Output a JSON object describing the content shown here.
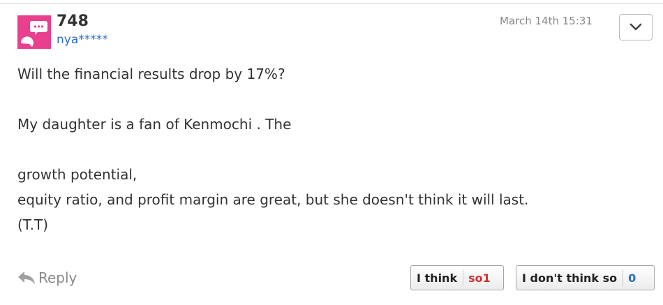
{
  "post": {
    "number": "748",
    "username": "nya*****",
    "timestamp": "March 14th 15:31",
    "body": {
      "line1": "Will the financial results drop by 17%?",
      "line2": "My daughter is a fan of Kenmochi . The",
      "line3": "growth potential,",
      "line4": "equity ratio, and profit margin are great, but she doesn't think it will last.",
      "line5": "(T.T)"
    }
  },
  "actions": {
    "reply_label": "Reply",
    "menu_icon": "chevron-down-icon"
  },
  "votes": {
    "agree": {
      "label": "I think",
      "count": "so1"
    },
    "disagree": {
      "label": "I don't think so",
      "count": "0"
    }
  },
  "colors": {
    "avatar_bg": "#e8408f",
    "username": "#2a6cc4",
    "agree_count": "#d03030",
    "disagree_count": "#2a6cc4"
  }
}
